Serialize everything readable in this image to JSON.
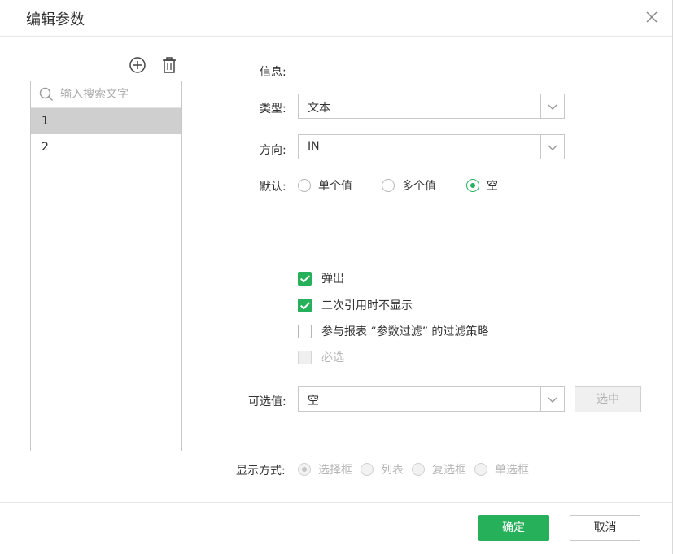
{
  "dialog": {
    "title": "编辑参数"
  },
  "param_list": {
    "search_placeholder": "输入搜索文字",
    "items": [
      "1",
      "2"
    ],
    "selected_index": 0
  },
  "form": {
    "info_label": "信息:",
    "type_label": "类型:",
    "type_value": "文本",
    "direction_label": "方向:",
    "direction_value": "IN",
    "default_label": "默认:",
    "default_options": [
      "单个值",
      "多个值",
      "空"
    ],
    "default_selected": "空",
    "checkboxes": [
      {
        "label": "弹出",
        "checked": true,
        "disabled": false
      },
      {
        "label": "二次引用时不显示",
        "checked": true,
        "disabled": false
      },
      {
        "label": "参与报表 “参数过滤” 的过滤策略",
        "checked": false,
        "disabled": false
      },
      {
        "label": "必选",
        "checked": false,
        "disabled": true
      }
    ],
    "optional_label": "可选值:",
    "optional_value": "空",
    "select_button": "选中",
    "display_label": "显示方式:",
    "display_options": [
      "选择框",
      "列表",
      "复选框",
      "单选框"
    ],
    "display_selected": "选择框"
  },
  "footer": {
    "ok": "确定",
    "cancel": "取消"
  },
  "colors": {
    "accent": "#27b05a",
    "selected_row": "#cfcfcf",
    "border": "#c8c8c8"
  }
}
